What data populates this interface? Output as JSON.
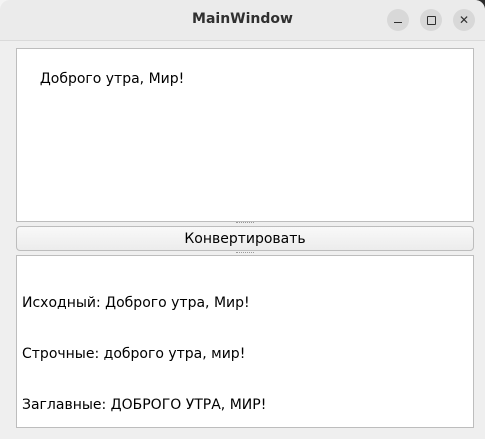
{
  "window": {
    "title": "MainWindow"
  },
  "input": {
    "value": "Доброго утра, Мир!"
  },
  "convert_button": {
    "label": "Конвертировать"
  },
  "output": {
    "lines": [
      "Исходный: Доброго утра, Мир!",
      "Строчные: доброго утра, мир!",
      "Заглавные: ДОБРОГО УТРА, МИР!"
    ]
  },
  "icons": {
    "minimize": "minimize-icon",
    "maximize": "maximize-icon",
    "close": "close-icon"
  }
}
